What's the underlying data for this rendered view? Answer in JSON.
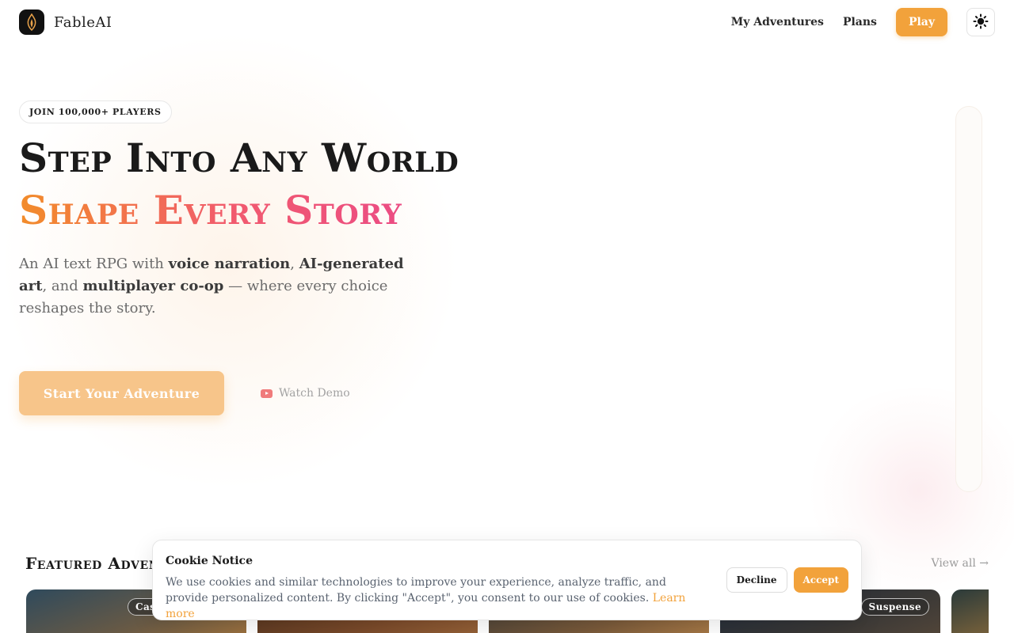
{
  "brand": {
    "name": "FableAI",
    "logo_icon": "quill-flame-icon",
    "accent": "#f2a23b"
  },
  "nav": {
    "my_adventures": "My Adventures",
    "plans": "Plans",
    "play": "Play",
    "theme_icon": "sun-icon"
  },
  "hero": {
    "badge": "JOIN 100,000+ PLAYERS",
    "title_line1": "Step Into Any World",
    "title_line2": "Shape Every Story",
    "subtitle_prefix": "An AI text RPG with ",
    "subtitle_b1": "voice narration",
    "subtitle_sep1": ", ",
    "subtitle_b2": "AI-generated art",
    "subtitle_sep2": ", and ",
    "subtitle_b3": "multiplayer co-op",
    "subtitle_suffix": " — where every choice reshapes the story.",
    "cta_start": "Start Your Adventure",
    "cta_demo": "Watch Demo",
    "demo_icon": "youtube-icon"
  },
  "featured": {
    "title": "Featured Adventures",
    "view_all": "View all →",
    "cards": [
      {
        "tag": "Cas"
      },
      {
        "tag": ""
      },
      {
        "tag": ""
      },
      {
        "tag": "Suspense"
      },
      {
        "tag": ""
      }
    ]
  },
  "cookie": {
    "title": "Cookie Notice",
    "text": "We use cookies and similar technologies to improve your experience, analyze traffic, and provide personalized content. By clicking \"Accept\", you consent to our use of cookies. ",
    "learn_more": "Learn more",
    "decline": "Decline",
    "accept": "Accept"
  }
}
